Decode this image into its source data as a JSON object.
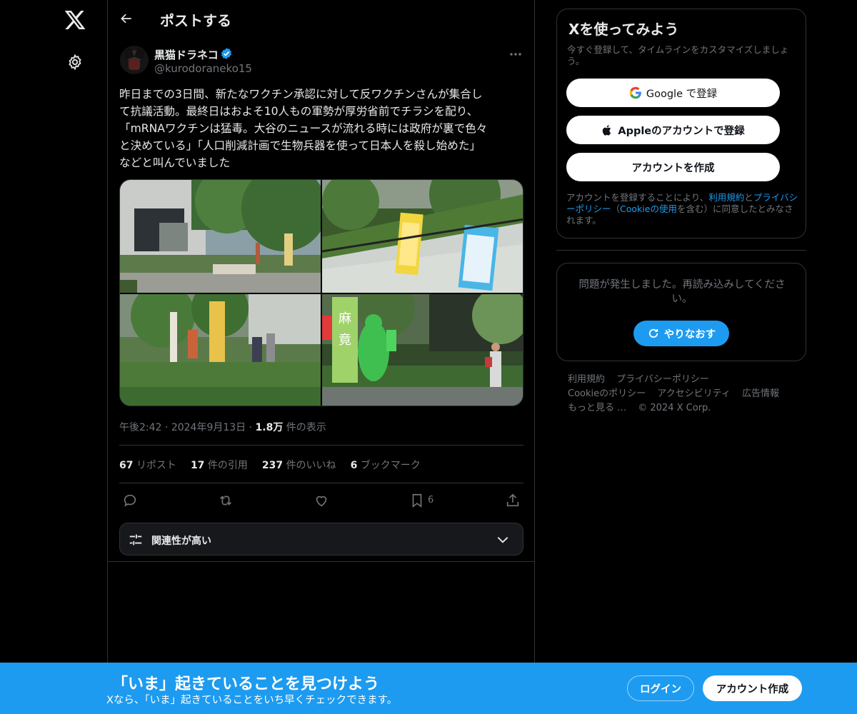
{
  "header": {
    "title": "ポストする"
  },
  "tweet": {
    "display_name": "黒猫ドラネコ",
    "handle": "@kurodoraneko15",
    "text_lines": [
      "昨日までの3日間、新たなワクチン承認に対して反ワクチンさんが集合し",
      "て抗議活動。最終日はおよそ10人もの軍勢が厚労省前でチラシを配り、",
      "「mRNAワクチンは猛毒。大谷のニュースが流れる時には政府が裏で色々",
      "と決めている」「人口削減計画で生物兵器を使って日本人を殺し始めた」",
      "などと叫んでいました"
    ],
    "time": "午後2:42",
    "date": "2024年9月13日",
    "views": "1.8万",
    "views_label": "件の表示",
    "stats": {
      "reposts": "67",
      "reposts_label": "リポスト",
      "quotes": "17",
      "quotes_label": "件の引用",
      "likes": "237",
      "likes_label": "件のいいね",
      "bookmarks": "6",
      "bookmarks_label": "ブックマーク"
    },
    "bookmark_count": "6",
    "relevance_label": "関連性が高い",
    "photo_signs": {
      "photo4_left": "麻",
      "photo4_left2": "竟"
    }
  },
  "signup": {
    "title": "Xを使ってみよう",
    "subtitle": "今すぐ登録して、タイムラインをカスタマイズしましょう。",
    "google_label": "Google で登録",
    "apple_label": "Appleのアカウントで登録",
    "create_label": "アカウントを作成",
    "terms_prefix": "アカウントを登録することにより、",
    "terms_link": "利用規約",
    "terms_and": "と",
    "privacy_link": "プライバシーポリシー",
    "terms_paren_open": "（",
    "cookie_link": "Cookieの使用",
    "terms_suffix": "を含む）に同意したとみなされます。"
  },
  "error": {
    "message": "問題が発生しました。再読み込みしてください。",
    "retry_label": "やりなおす"
  },
  "footer": {
    "links": [
      "利用規約",
      "プライバシーポリシー",
      "Cookieのポリシー",
      "アクセシビリティ",
      "広告情報",
      "もっと見る …"
    ],
    "copyright": "© 2024 X Corp."
  },
  "banner": {
    "title": "「いま」起きていることを見つけよう",
    "subtitle": "Xなら、「いま」起きていることをいち早くチェックできます。",
    "login_label": "ログイン",
    "signup_label": "アカウント作成"
  },
  "colors": {
    "accent": "#1d9bf0",
    "background": "#000000",
    "border": "#2f3336",
    "muted": "#71767b",
    "text": "#e7e9ea"
  },
  "icons": [
    "x-logo-icon",
    "gear-icon",
    "back-arrow-icon",
    "verified-icon",
    "more-icon",
    "reply-icon",
    "repost-icon",
    "like-icon",
    "bookmark-icon",
    "share-icon",
    "sliders-icon",
    "chevron-down-icon",
    "google-icon",
    "apple-icon",
    "refresh-icon"
  ]
}
